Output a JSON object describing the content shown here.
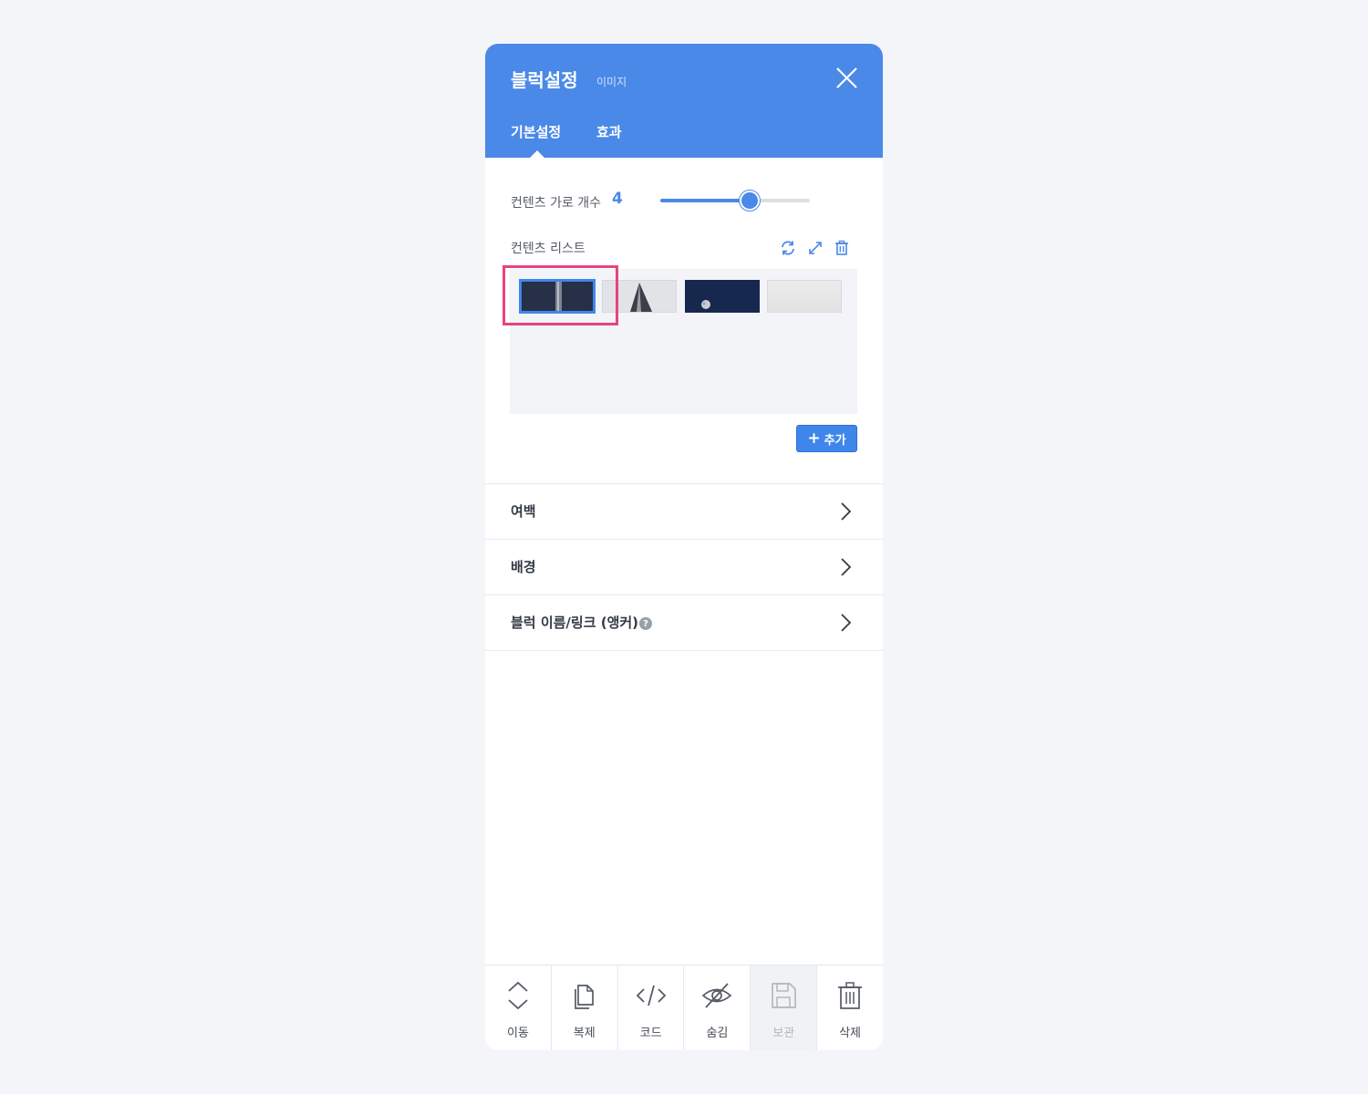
{
  "header": {
    "title": "블럭설정",
    "subtitle": "이미지",
    "tabs": [
      {
        "label": "기본설정",
        "active": true
      },
      {
        "label": "효과",
        "active": false
      }
    ]
  },
  "content_columns": {
    "label": "컨텐츠 가로 개수",
    "value": "4",
    "slider_fraction": 0.6
  },
  "content_list": {
    "label": "컨텐츠 리스트",
    "tools": [
      "refresh-icon",
      "expand-icon",
      "trash-icon"
    ],
    "items": [
      {
        "kind": "dark-split",
        "selected": true
      },
      {
        "kind": "light-road",
        "selected": false
      },
      {
        "kind": "navy-moon",
        "selected": false
      },
      {
        "kind": "light-plain",
        "selected": false
      }
    ],
    "add_label": "추가"
  },
  "sections": [
    {
      "label": "여백"
    },
    {
      "label": "배경"
    },
    {
      "label": "블럭 이름/링크 (앵커)",
      "help": true
    }
  ],
  "footer": [
    {
      "label": "이동",
      "icon": "move-updown-icon",
      "disabled": false
    },
    {
      "label": "복제",
      "icon": "copy-icon",
      "disabled": false
    },
    {
      "label": "코드",
      "icon": "code-icon",
      "disabled": false
    },
    {
      "label": "숨김",
      "icon": "eye-off-icon",
      "disabled": false
    },
    {
      "label": "보관",
      "icon": "save-icon",
      "disabled": true
    },
    {
      "label": "삭제",
      "icon": "trash-icon",
      "disabled": false
    }
  ],
  "colors": {
    "accent": "#4a89e8",
    "highlight": "#e8437f",
    "background": "#f3f5f9"
  }
}
